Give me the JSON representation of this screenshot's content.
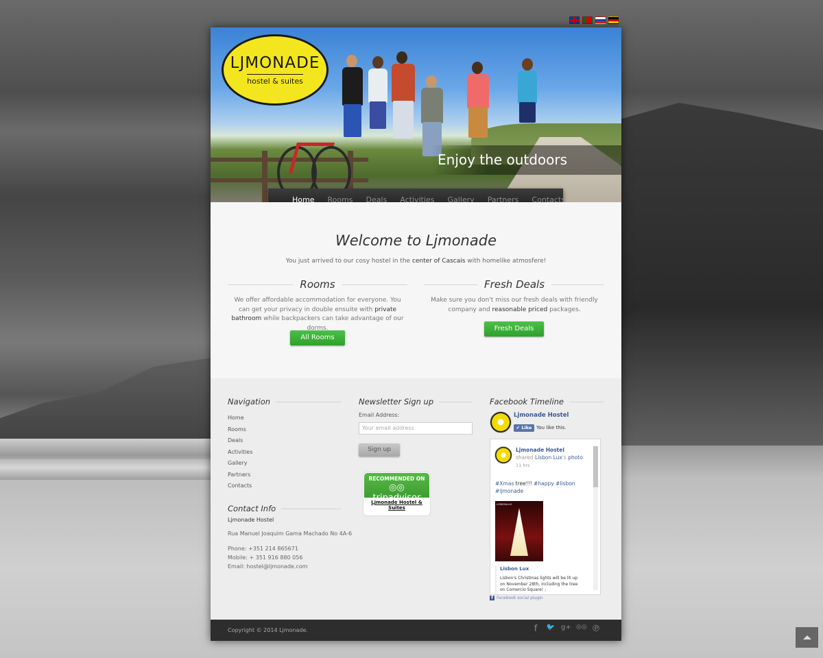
{
  "languages": [
    {
      "code": "en",
      "icon": "uk-flag-icon"
    },
    {
      "code": "pt",
      "icon": "portugal-flag-icon"
    },
    {
      "code": "ru",
      "icon": "russia-flag-icon"
    },
    {
      "code": "de",
      "icon": "germany-flag-icon"
    }
  ],
  "logo": {
    "name": "LJMONADE",
    "sub": "hostel & suites"
  },
  "hero": {
    "caption": "Enjoy the outdoors"
  },
  "nav": {
    "items": [
      "Home",
      "Rooms",
      "Deals",
      "Activities",
      "Gallery",
      "Partners",
      "Contacts"
    ],
    "active": "Home"
  },
  "welcome": {
    "title": "Welcome to Ljmonade",
    "sub_before": "You just arrived to our cosy hostel in the ",
    "sub_bold": "center of Cascais",
    "sub_after": " with homelike atmosfere!"
  },
  "rooms": {
    "heading": "Rooms",
    "text_1": "We offer affordable accommodation for everyone. You can get your privacy in double ensuite with ",
    "text_bold": "private bathroom",
    "text_2": " while backpackers can take advantage of our dorms.",
    "button": "All Rooms"
  },
  "deals": {
    "heading": "Fresh Deals",
    "text_1": "Make sure you don't miss our fresh deals with friendly company and ",
    "text_bold": "reasonable priced",
    "text_2": " packages.",
    "button": "Fresh Deals"
  },
  "footer_nav": {
    "heading": "Navigation",
    "items": [
      "Home",
      "Rooms",
      "Deals",
      "Activities",
      "Gallery",
      "Partners",
      "Contacts"
    ]
  },
  "contact": {
    "heading": "Contact Info",
    "name": "Ljmonade Hostel",
    "address": "Rua Manuel Joaquim Gama Machado No 4A-6",
    "phone": "Phone: +351 214 865671",
    "mobile": "Mobile: + 351 916 880 056",
    "email": "Email: hostel@ljmonade.com"
  },
  "newsletter": {
    "heading": "Newsletter Sign up",
    "label": "Email Address:",
    "placeholder": "Your email address",
    "button": "Sign up"
  },
  "tripadvisor": {
    "recommended": "RECOMMENDED ON",
    "brand": "tripadvisor",
    "name": "Ljmonade Hostel & Suites"
  },
  "facebook": {
    "heading": "Facebook Timeline",
    "page": "Ljmonade Hostel",
    "like": "Like",
    "likes_text": "You like this.",
    "post_author": "Ljmonade Hostel",
    "post_action": "shared ",
    "post_source": "Lisbon Lux",
    "post_action_2": "'s ",
    "post_photo": "photo",
    "post_time": "11 hrs",
    "post_text_1": "#Xmas",
    "post_text_2": " tree!!! ",
    "post_text_3": "#happy #lisbon",
    "post_text_4": "#ljmonade",
    "photo_label": "LISBONLUX",
    "link_title": "Lisbon Lux",
    "link_text": "Lisbon's Christmas lights will be lit up on November 28th, including the tree on Comercio Square! ;",
    "plugin": "Facebook social plugin"
  },
  "bottom": {
    "copyright": "Copyright © 2014 Ljmonade.",
    "social": [
      {
        "icon": "facebook-icon",
        "glyph": "f"
      },
      {
        "icon": "twitter-icon",
        "glyph": "🐦"
      },
      {
        "icon": "google-plus-icon",
        "glyph": "g+"
      },
      {
        "icon": "tripadvisor-icon",
        "glyph": "◎◎"
      },
      {
        "icon": "pinterest-icon",
        "glyph": "℗"
      }
    ]
  },
  "colors": {
    "accent_green": "#3db43a",
    "logo_yellow": "#f3e61f",
    "facebook_blue": "#3b5998"
  }
}
